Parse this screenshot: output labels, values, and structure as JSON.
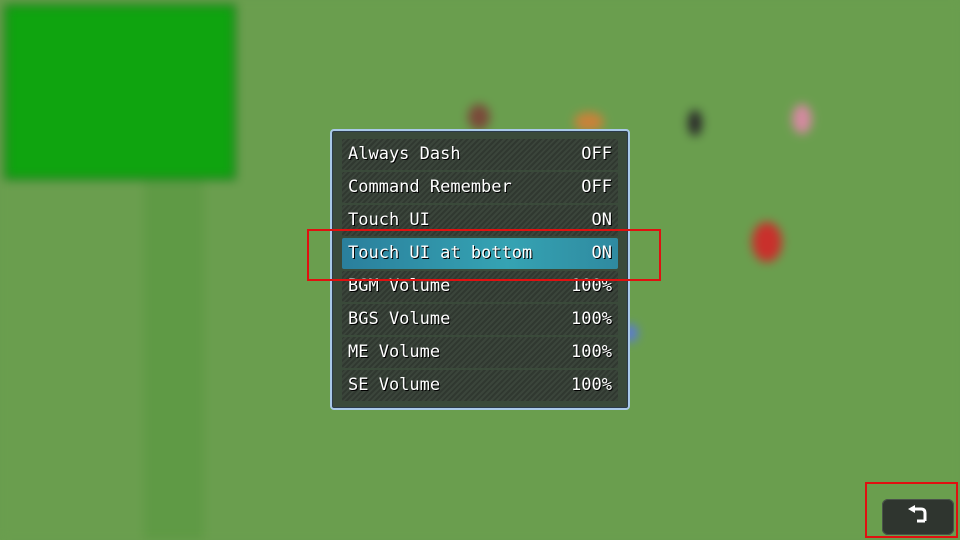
{
  "options": [
    {
      "label": "Always Dash",
      "value": "OFF",
      "selected": false
    },
    {
      "label": "Command Remember",
      "value": "OFF",
      "selected": false
    },
    {
      "label": "Touch UI",
      "value": "ON",
      "selected": false
    },
    {
      "label": "Touch UI at bottom",
      "value": "ON",
      "selected": true
    },
    {
      "label": "BGM Volume",
      "value": "100%",
      "selected": false
    },
    {
      "label": "BGS Volume",
      "value": "100%",
      "selected": false
    },
    {
      "label": "ME Volume",
      "value": "100%",
      "selected": false
    },
    {
      "label": "SE Volume",
      "value": "100%",
      "selected": false
    }
  ],
  "back_button": {
    "icon": "return-arrow-icon"
  },
  "colors": {
    "highlight": "#e01010",
    "selected_row": "#35a3b3",
    "window_border": "#a9c9e8"
  }
}
